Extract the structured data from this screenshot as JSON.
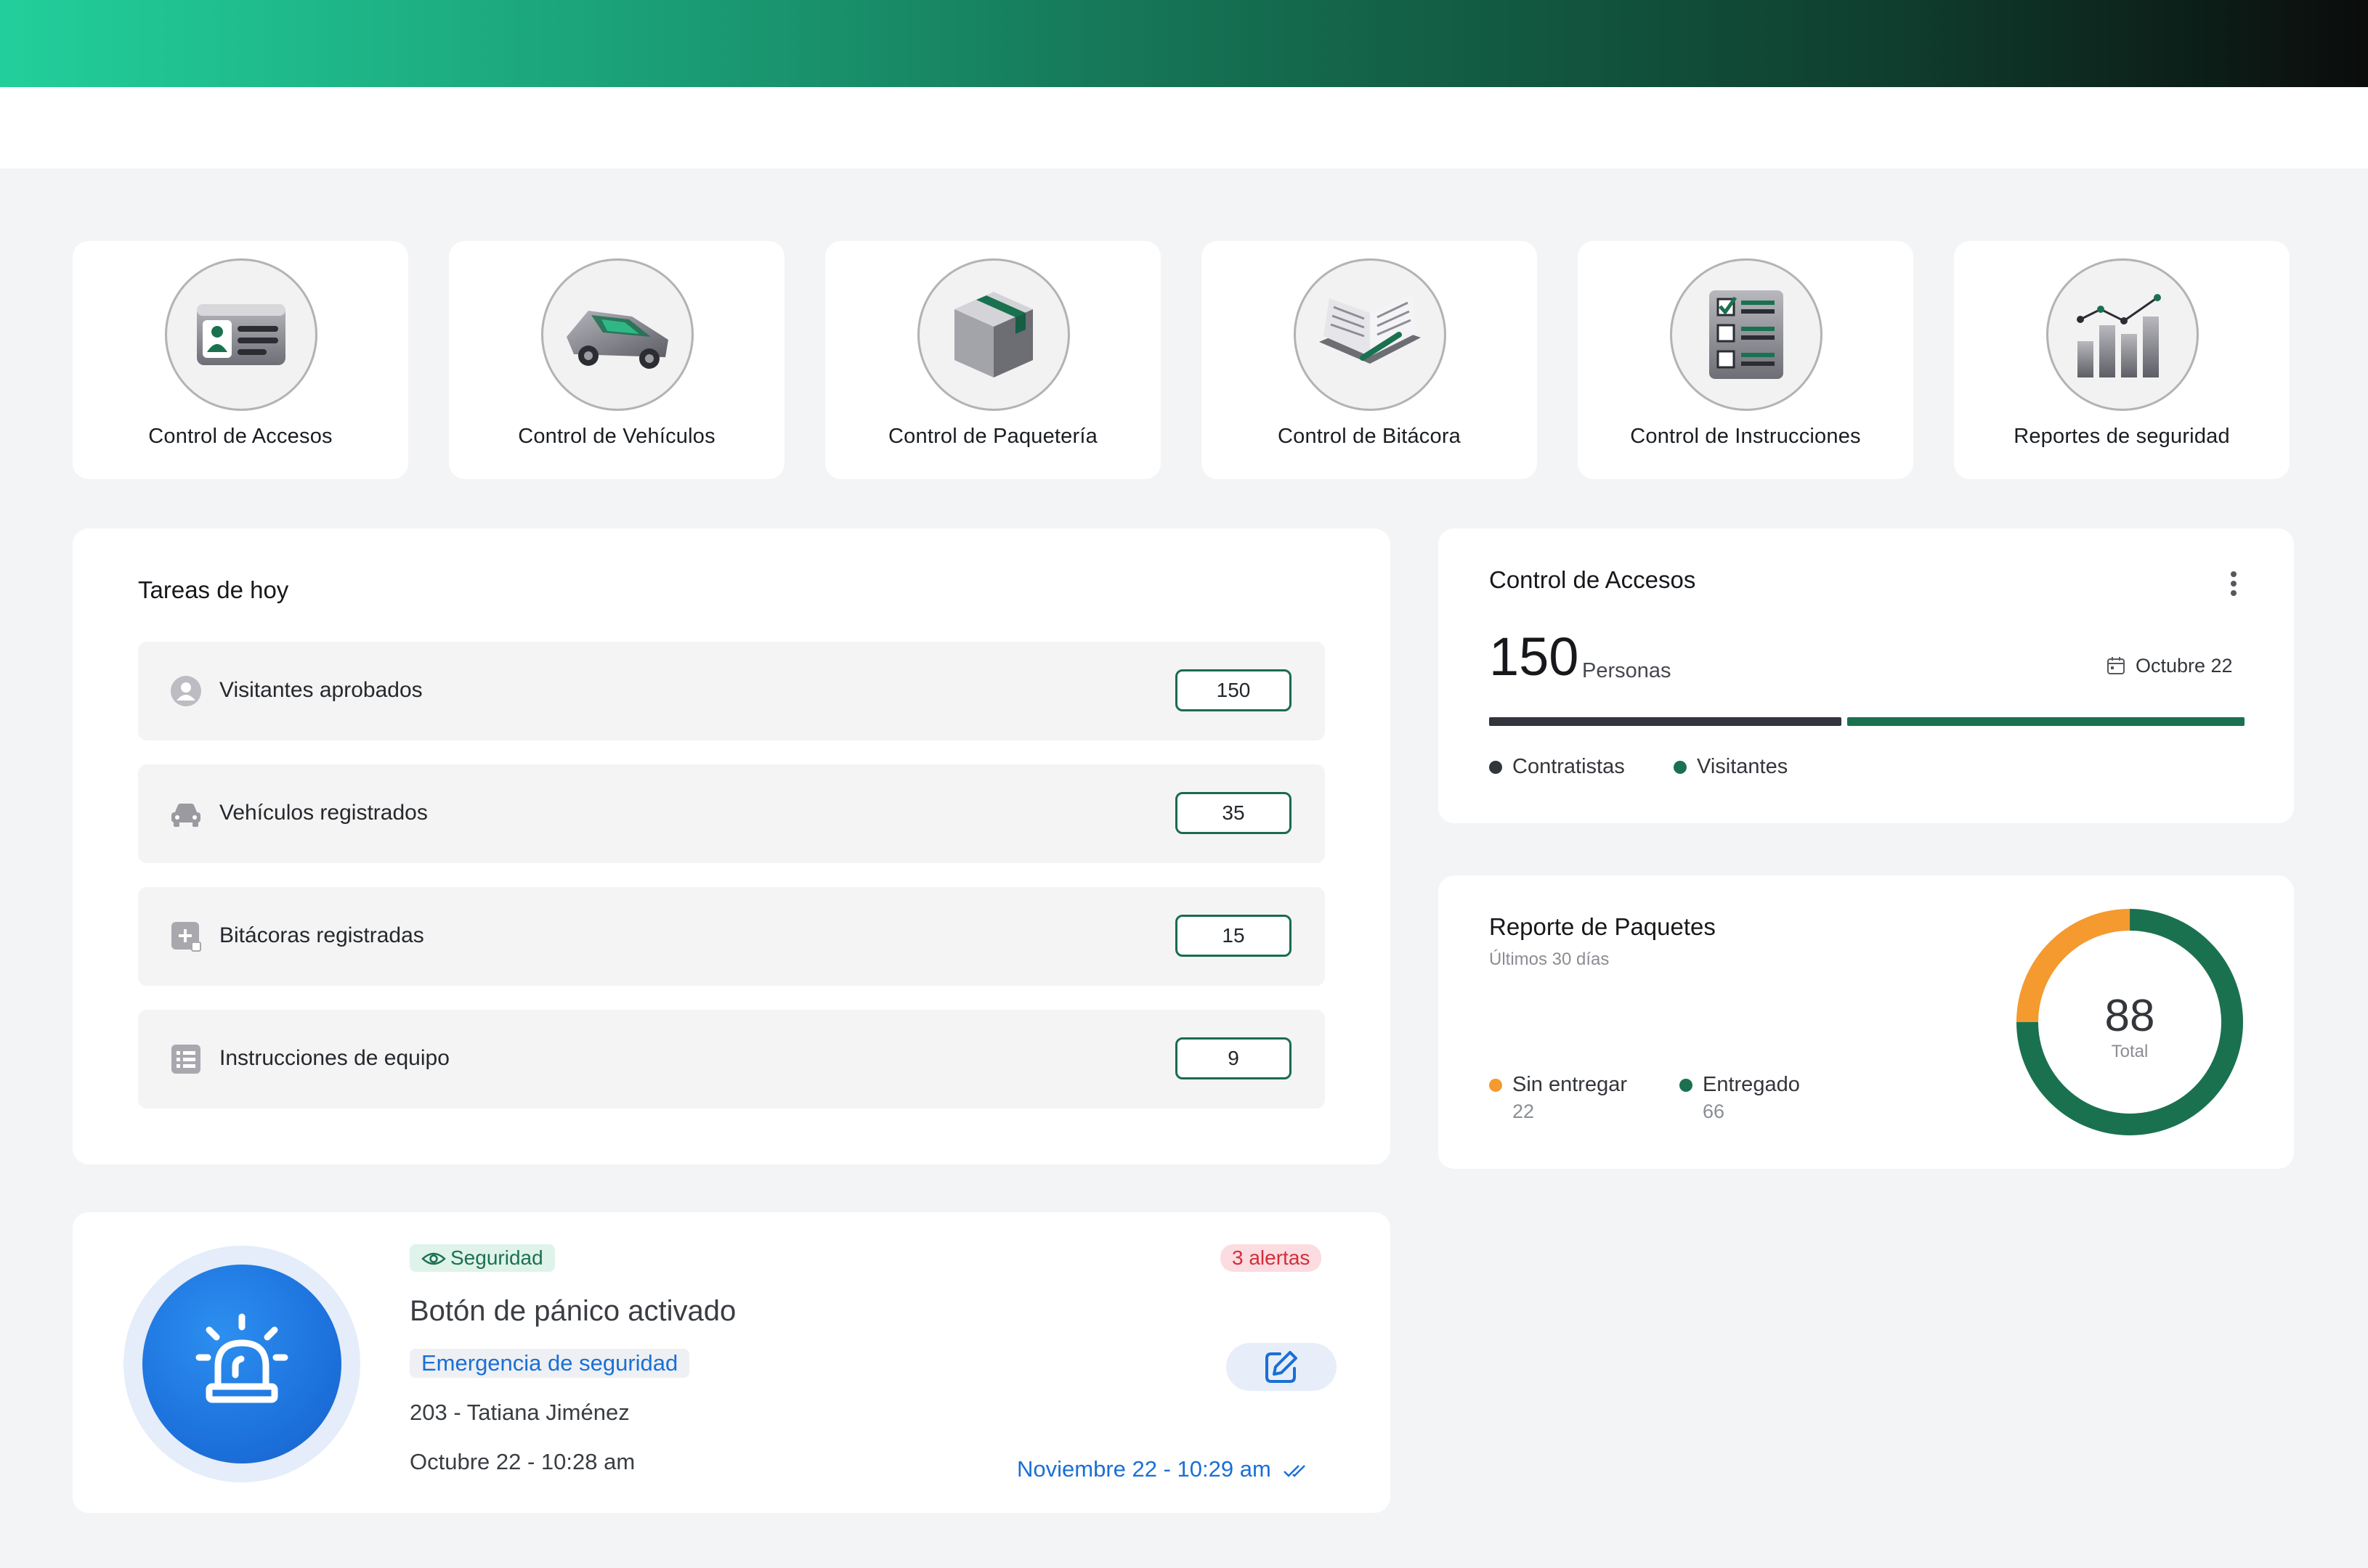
{
  "modules": [
    {
      "label": "Control de Accesos",
      "icon": "id-card-icon"
    },
    {
      "label": "Control de Vehículos",
      "icon": "car-icon"
    },
    {
      "label": "Control de Paquetería",
      "icon": "package-box-icon"
    },
    {
      "label": "Control de Bitácora",
      "icon": "logbook-icon"
    },
    {
      "label": "Control de Instrucciones",
      "icon": "checklist-icon"
    },
    {
      "label": "Reportes de seguridad",
      "icon": "bar-chart-icon"
    }
  ],
  "tasks": {
    "title": "Tareas de hoy",
    "items": [
      {
        "label": "Visitantes aprobados",
        "count": "150",
        "icon": "user-icon"
      },
      {
        "label": "Vehículos registrados",
        "count": "35",
        "icon": "car-icon"
      },
      {
        "label": "Bitácoras registradas",
        "count": "15",
        "icon": "add-note-icon"
      },
      {
        "label": "Instrucciones de equipo",
        "count": "9",
        "icon": "list-icon"
      }
    ]
  },
  "access": {
    "title": "Control de Accesos",
    "menu_icon": "more-vertical-icon",
    "count": "150",
    "unit": "Personas",
    "date": "Octubre 22",
    "date_icon": "calendar-icon",
    "legend": [
      {
        "label": "Contratistas",
        "color": "#33353c"
      },
      {
        "label": "Visitantes",
        "color": "#1a7150"
      }
    ],
    "contractor_share": 0.47
  },
  "packages": {
    "title": "Reporte de Paquetes",
    "subtitle": "Últimos 30 días",
    "total": "88",
    "total_label": "Total",
    "legend": [
      {
        "label": "Sin entregar",
        "value": "22",
        "color": "#f49a2e"
      },
      {
        "label": "Entregado",
        "value": "66",
        "color": "#1a7150"
      }
    ]
  },
  "alert": {
    "category": "Seguridad",
    "category_icon": "eye-icon",
    "alerts_badge": "3 alertas",
    "title": "Botón de pánico activado",
    "type": "Emergencia de seguridad",
    "resident": "203 - Tatiana Jiménez",
    "created": "Octubre 22 - 10:28 am",
    "resolved": "Noviembre 22 - 10:29 am",
    "icon": "siren-icon",
    "edit_icon": "edit-icon",
    "check_icon": "double-check-icon"
  },
  "colors": {
    "brand_green": "#1a7150",
    "dark": "#33353c",
    "orange": "#f49a2e",
    "blue": "#1a6fd6",
    "alert_red": "#d32d3b"
  }
}
